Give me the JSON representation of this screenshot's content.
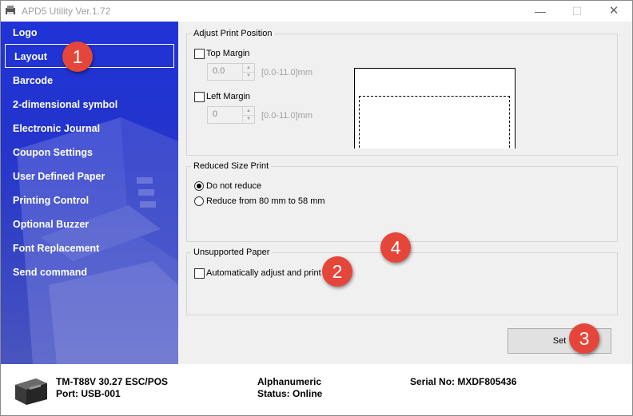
{
  "window": {
    "title": "APD5 Utility Ver.1.72",
    "minimize_glyph": "—",
    "maximize_glyph": "☐",
    "close_glyph": "✕"
  },
  "sidebar": {
    "items": [
      {
        "label": "Logo"
      },
      {
        "label": "Layout",
        "selected": true
      },
      {
        "label": "Barcode"
      },
      {
        "label": "2-dimensional symbol"
      },
      {
        "label": "Electronic Journal"
      },
      {
        "label": "Coupon Settings"
      },
      {
        "label": "User Defined Paper"
      },
      {
        "label": "Printing Control"
      },
      {
        "label": "Optional Buzzer"
      },
      {
        "label": "Font Replacement"
      },
      {
        "label": "Send command"
      }
    ]
  },
  "adjust_print_position": {
    "title": "Adjust Print Position",
    "top_margin": {
      "label": "Top Margin",
      "checked": false,
      "value": "0.0",
      "range": "[0.0-11.0]mm"
    },
    "left_margin": {
      "label": "Left Margin",
      "checked": false,
      "value": "0",
      "range": "[0.0-11.0]mm"
    }
  },
  "reduced_size_print": {
    "title": "Reduced Size Print",
    "options": [
      {
        "label": "Do not reduce",
        "checked": true
      },
      {
        "label": "Reduce from 80 mm to 58 mm",
        "checked": false
      }
    ]
  },
  "unsupported_paper": {
    "title": "Unsupported Paper",
    "auto_adjust": {
      "label": "Automatically adjust and print",
      "checked": false
    }
  },
  "set_button": {
    "label": "Set"
  },
  "badges": [
    "1",
    "2",
    "3",
    "4"
  ],
  "status": {
    "model": "TM-T88V 30.27 ESC/POS",
    "port": "Port: USB-001",
    "mode": "Alphanumeric",
    "status": "Status: Online",
    "serial": "Serial No: MXDF805436"
  },
  "colors": {
    "sidebar_top": "#1f33d6",
    "sidebar_bottom": "#4a55bf",
    "badge": "#e5463a"
  }
}
